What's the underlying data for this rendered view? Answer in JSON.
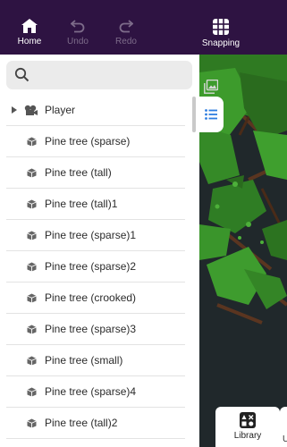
{
  "toolbar": {
    "home_label": "Home",
    "undo_label": "Undo",
    "redo_label": "Redo",
    "snapping_label": "Snapping"
  },
  "search": {
    "placeholder": ""
  },
  "tree": {
    "items": [
      {
        "label": "Player",
        "icon": "player-object-icon",
        "expandable": true
      },
      {
        "label": "Pine tree (sparse)",
        "icon": "object-cube-icon"
      },
      {
        "label": "Pine tree (tall)",
        "icon": "object-cube-icon"
      },
      {
        "label": "Pine tree (tall)1",
        "icon": "object-cube-icon"
      },
      {
        "label": "Pine tree (sparse)1",
        "icon": "object-cube-icon"
      },
      {
        "label": "Pine tree (sparse)2",
        "icon": "object-cube-icon"
      },
      {
        "label": "Pine tree (crooked)",
        "icon": "object-cube-icon"
      },
      {
        "label": "Pine tree (sparse)3",
        "icon": "object-cube-icon"
      },
      {
        "label": "Pine tree (small)",
        "icon": "object-cube-icon"
      },
      {
        "label": "Pine tree (sparse)4",
        "icon": "object-cube-icon"
      },
      {
        "label": "Pine tree (tall)2",
        "icon": "object-cube-icon"
      }
    ]
  },
  "bottom_tabs": {
    "library_label": "Library",
    "next_label": "U"
  },
  "colors": {
    "toolbar_bg": "#2e1342",
    "accent_blue": "#2d7de0",
    "game_bg": "#20282b"
  }
}
